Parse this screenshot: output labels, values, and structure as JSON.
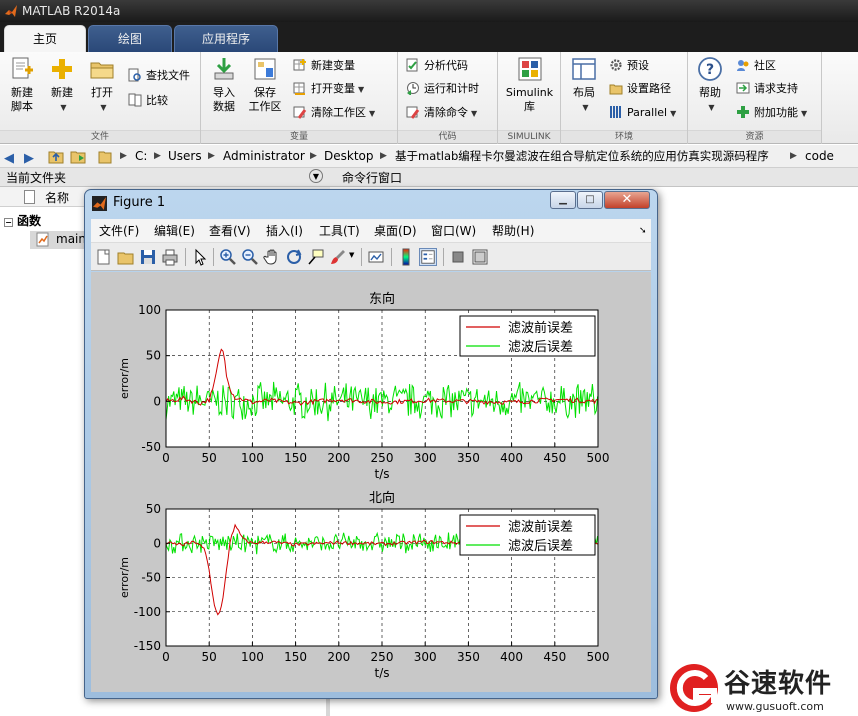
{
  "window": {
    "title": "MATLAB R2014a"
  },
  "ribbon_tabs": [
    "主页",
    "绘图",
    "应用程序"
  ],
  "ribbon": {
    "file": {
      "label": "文件",
      "new_script": "新建\n脚本",
      "new": "新建",
      "open": "打开",
      "find_files": "查找文件",
      "compare": "比较"
    },
    "variable": {
      "label": "变量",
      "import_data": "导入\n数据",
      "save_workspace": "保存\n工作区",
      "new_variable": "新建变量",
      "open_variable": "打开变量",
      "clear_workspace": "清除工作区"
    },
    "code": {
      "label": "代码",
      "analyze_code": "分析代码",
      "run_and_time": "运行和计时",
      "clear_commands": "清除命令"
    },
    "simulink": {
      "label": "SIMULINK",
      "library": "Simulink\n库"
    },
    "environment": {
      "label": "环境",
      "layout": "布局",
      "preferences": "预设",
      "set_path": "设置路径",
      "parallel": "Parallel"
    },
    "resources": {
      "label": "资源",
      "help": "帮助",
      "community": "社区",
      "request_support": "请求支持",
      "add_ons": "附加功能"
    }
  },
  "address": {
    "crumbs": [
      "C:",
      "Users",
      "Administrator",
      "Desktop",
      "基于matlab编程卡尔曼滤波在组合导航定位系统的应用仿真实现源码程序",
      "code"
    ]
  },
  "panels": {
    "current_folder": "当前文件夹",
    "command_window": "命令行窗口",
    "name_col": "名称",
    "group_functions": "函数",
    "file_main": "main"
  },
  "figure": {
    "title": "Figure 1",
    "menu": [
      "文件(F)",
      "编辑(E)",
      "查看(V)",
      "插入(I)",
      "工具(T)",
      "桌面(D)",
      "窗口(W)",
      "帮助(H)"
    ],
    "tools": [
      "new-figure-icon",
      "open-icon",
      "save-icon",
      "print-icon",
      "pointer-icon",
      "zoom-in-icon",
      "zoom-out-icon",
      "pan-icon",
      "rotate-icon",
      "data-cursor-icon",
      "brush-icon",
      "link-icon",
      "colorbar-icon",
      "legend-icon",
      "hide-plot-tools-icon",
      "show-plot-tools-icon"
    ]
  },
  "chart_data": [
    {
      "type": "line",
      "title": "东向",
      "xlabel": "t/s",
      "ylabel": "error/m",
      "xlim": [
        0,
        500
      ],
      "ylim": [
        -50,
        100
      ],
      "xticks": [
        0,
        50,
        100,
        150,
        200,
        250,
        300,
        350,
        400,
        450,
        500
      ],
      "yticks": [
        -50,
        0,
        50,
        100
      ],
      "grid": true,
      "legend_position": "top-right",
      "series": [
        {
          "name": "滤波前误差",
          "color": "#d00000",
          "x": [
            0,
            20,
            40,
            50,
            55,
            60,
            64,
            67,
            70,
            75,
            80,
            90,
            100,
            120,
            150,
            200,
            250,
            300,
            350,
            400,
            450,
            500
          ],
          "y": [
            0,
            3,
            -2,
            2,
            15,
            40,
            58,
            52,
            30,
            12,
            4,
            2,
            -1,
            1,
            -2,
            2,
            -1,
            1,
            0,
            -1,
            2,
            0
          ]
        },
        {
          "name": "滤波后误差",
          "color": "#00e000",
          "noise_amplitude": 22
        }
      ]
    },
    {
      "type": "line",
      "title": "北向",
      "xlabel": "t/s",
      "ylabel": "error/m",
      "xlim": [
        0,
        500
      ],
      "ylim": [
        -150,
        50
      ],
      "xticks": [
        0,
        50,
        100,
        150,
        200,
        250,
        300,
        350,
        400,
        450,
        500
      ],
      "yticks": [
        -150,
        -100,
        -50,
        0,
        50
      ],
      "grid": true,
      "legend_position": "top-right",
      "series": [
        {
          "name": "滤波前误差",
          "color": "#d00000",
          "x": [
            0,
            20,
            35,
            45,
            50,
            55,
            60,
            65,
            70,
            75,
            80,
            90,
            100,
            120,
            150,
            200,
            250,
            300,
            350,
            400,
            450,
            500
          ],
          "y": [
            0,
            -2,
            2,
            -10,
            -40,
            -85,
            -105,
            -90,
            -40,
            10,
            25,
            5,
            0,
            2,
            -2,
            1,
            -1,
            2,
            0,
            -1,
            1,
            0
          ]
        },
        {
          "name": "滤波后误差",
          "color": "#00e000",
          "noise_amplitude": 17
        }
      ]
    }
  ]
}
